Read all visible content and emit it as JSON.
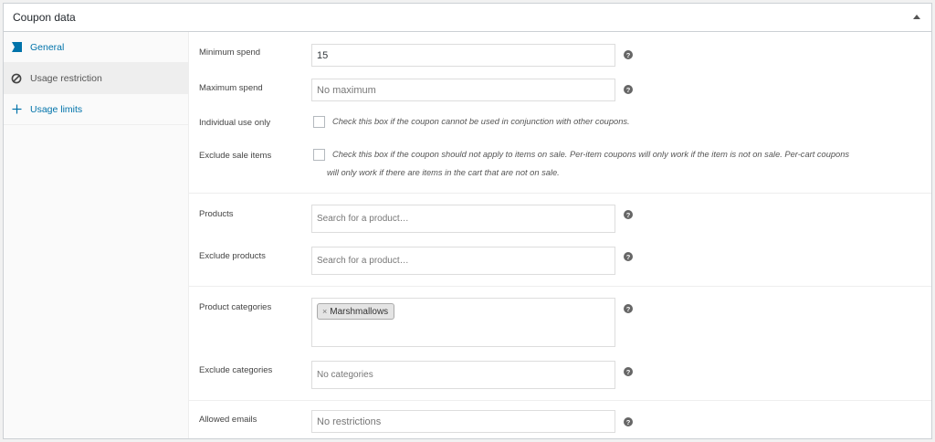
{
  "panel": {
    "title": "Coupon data"
  },
  "tabs": [
    {
      "label": "General"
    },
    {
      "label": "Usage restriction"
    },
    {
      "label": "Usage limits"
    }
  ],
  "fields": {
    "minimum_spend": {
      "label": "Minimum spend",
      "value": "15"
    },
    "maximum_spend": {
      "label": "Maximum spend",
      "placeholder": "No maximum"
    },
    "individual_use": {
      "label": "Individual use only",
      "description": "Check this box if the coupon cannot be used in conjunction with other coupons."
    },
    "exclude_sale": {
      "label": "Exclude sale items",
      "description_line1": "Check this box if the coupon should not apply to items on sale. Per-item coupons will only work if the item is not on sale. Per-cart coupons",
      "description_line2": "will only work if there are items in the cart that are not on sale."
    },
    "products": {
      "label": "Products",
      "placeholder": "Search for a product…"
    },
    "exclude_products": {
      "label": "Exclude products",
      "placeholder": "Search for a product…"
    },
    "product_categories": {
      "label": "Product categories",
      "chip": "Marshmallows",
      "chip_remove": "×"
    },
    "exclude_categories": {
      "label": "Exclude categories",
      "placeholder": "No categories"
    },
    "allowed_emails": {
      "label": "Allowed emails",
      "placeholder": "No restrictions"
    }
  },
  "help_glyph": "?"
}
